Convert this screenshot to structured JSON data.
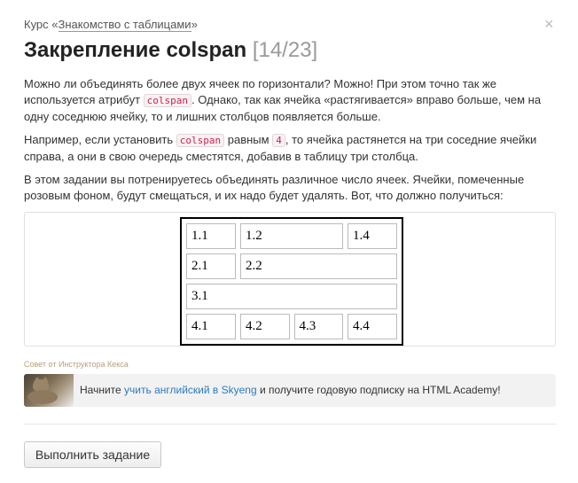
{
  "header": {
    "course_prefix": "Курс «",
    "course_link": "Знакомство с таблицами",
    "course_suffix": "»",
    "close_symbol": "×",
    "title": "Закрепление colspan",
    "progress": "[14/23]"
  },
  "content": {
    "p1_a": "Можно ли объединять более двух ячеек по горизонтали? Можно! При этом точно так же используется атрибут",
    "p1_code": "colspan",
    "p1_b": ". Однако, так как ячейка «растягивается» вправо больше, чем на одну соседнюю ячейку, то и лишних столбцов появляется больше.",
    "p2_a": "Например, если установить",
    "p2_code1": "colspan",
    "p2_b": "равным",
    "p2_code2": "4",
    "p2_c": ", то ячейка растянется на три соседние ячейки справа, а они в свою очередь сместятся, добавив в таблицу три столбца.",
    "p3": "В этом задании вы потренируетесь объединять различное число ячеек. Ячейки, помеченные розовым фоном, будут смещаться, и их надо будет удалять. Вот, что должно получиться:"
  },
  "preview_table": {
    "r1": [
      "1.1",
      "1.2",
      "1.4"
    ],
    "r2": [
      "2.1",
      "2.2"
    ],
    "r3": [
      "3.1"
    ],
    "r4": [
      "4.1",
      "4.2",
      "4.3",
      "4.4"
    ]
  },
  "tip": {
    "label": "Совет от Инструктора Кекса",
    "text_a": "Начните",
    "link": "учить английский в Skyeng",
    "text_b": "и получите годовую подписку на HTML Academy!"
  },
  "actions": {
    "submit_label": "Выполнить задание"
  },
  "colors": {
    "code_text": "#c7254e",
    "link": "#2b7bbf",
    "tip_label": "#b8a179"
  }
}
